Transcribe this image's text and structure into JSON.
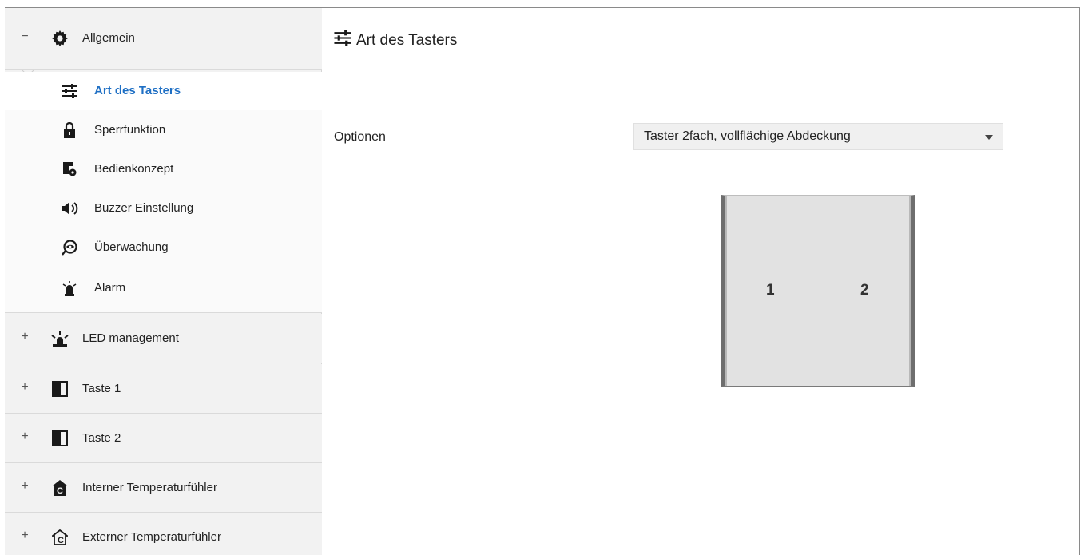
{
  "sidebar": {
    "groups": [
      {
        "expander": "−",
        "icon": "gear-icon",
        "label": "Allgemein"
      },
      {
        "expander": "+",
        "icon": "led-alarm-icon",
        "label": "LED management"
      },
      {
        "expander": "+",
        "icon": "half-square-icon",
        "label": "Taste 1"
      },
      {
        "expander": "+",
        "icon": "half-square-icon",
        "label": "Taste 2"
      },
      {
        "expander": "+",
        "icon": "internal-temp-icon",
        "label": "Interner Temperaturfühler"
      },
      {
        "expander": "+",
        "icon": "external-temp-icon",
        "label": "Externer Temperaturfühler"
      }
    ],
    "children": [
      {
        "icon": "sliders-icon",
        "label": "Art des Tasters",
        "selected": true
      },
      {
        "icon": "lock-icon",
        "label": "Sperrfunktion"
      },
      {
        "icon": "operation-concept-icon",
        "label": "Bedienkonzept"
      },
      {
        "icon": "speaker-icon",
        "label": "Buzzer Einstellung"
      },
      {
        "icon": "monitoring-eye-icon",
        "label": "Überwachung"
      },
      {
        "icon": "alarm-light-icon",
        "label": "Alarm"
      }
    ]
  },
  "main": {
    "title": "Art des Tasters",
    "option_label": "Optionen",
    "option_value": "Taster 2fach, vollflächige Abdeckung",
    "device": {
      "button_1": "1",
      "button_2": "2"
    }
  },
  "colors": {
    "selected_text": "#1e6fc4",
    "sidebar_bg": "#f2f2f2"
  }
}
